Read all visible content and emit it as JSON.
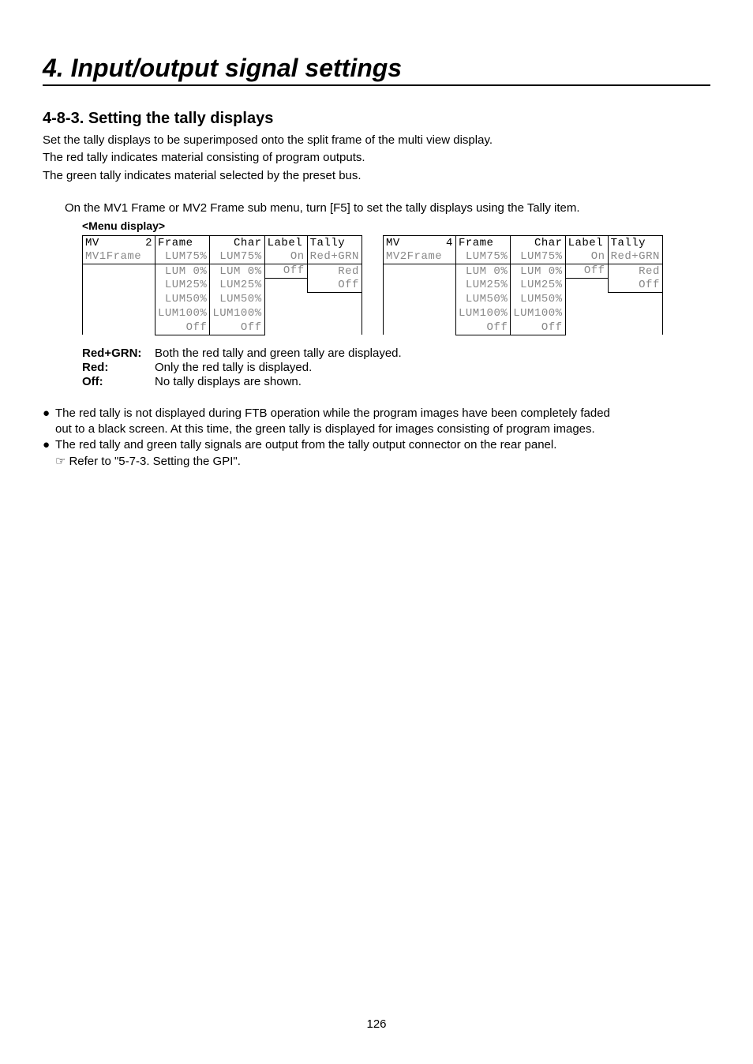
{
  "chapter_title": "4. Input/output signal settings",
  "section_number": "4-8-3.",
  "section_title": "Setting the tally displays",
  "intro_lines": [
    "Set the tally displays to be superimposed onto the split frame of the multi view display.",
    "The red tally indicates material consisting of program outputs.",
    "The green tally indicates material selected by the preset bus."
  ],
  "step_line": "On the MV1 Frame or MV2 Frame sub menu, turn [F5] to set the tally displays using the Tally item.",
  "menu_display_label": "<Menu display>",
  "table_left": {
    "hdr": {
      "menu": "MV",
      "page": "2",
      "frame": "Frame",
      "char": "Char",
      "label": "Label",
      "tally": "Tally"
    },
    "val": {
      "menu": "MV1Frame",
      "frame": "LUM75%",
      "char": "LUM75%",
      "label": "On",
      "tally": "Red+GRN"
    },
    "opts": [
      {
        "frame": "LUM 0%",
        "char": "LUM 0%",
        "label": "Off",
        "tally": "Red"
      },
      {
        "frame": "LUM25%",
        "char": "LUM25%",
        "label": "",
        "tally": "Off"
      },
      {
        "frame": "LUM50%",
        "char": "LUM50%",
        "label": "",
        "tally": ""
      },
      {
        "frame": "LUM100%",
        "char": "LUM100%",
        "label": "",
        "tally": ""
      },
      {
        "frame": "Off",
        "char": "Off",
        "label": "",
        "tally": ""
      }
    ]
  },
  "table_right": {
    "hdr": {
      "menu": "MV",
      "page": "4",
      "frame": "Frame",
      "char": "Char",
      "label": "Label",
      "tally": "Tally"
    },
    "val": {
      "menu": "MV2Frame",
      "frame": "LUM75%",
      "char": "LUM75%",
      "label": "On",
      "tally": "Red+GRN"
    },
    "opts": [
      {
        "frame": "LUM 0%",
        "char": "LUM 0%",
        "label": "Off",
        "tally": "Red"
      },
      {
        "frame": "LUM25%",
        "char": "LUM25%",
        "label": "",
        "tally": "Off"
      },
      {
        "frame": "LUM50%",
        "char": "LUM50%",
        "label": "",
        "tally": ""
      },
      {
        "frame": "LUM100%",
        "char": "LUM100%",
        "label": "",
        "tally": ""
      },
      {
        "frame": "Off",
        "char": "Off",
        "label": "",
        "tally": ""
      }
    ]
  },
  "legend": {
    "redgrn": {
      "key": "Red+GRN:",
      "desc": "Both the red tally and green tally are displayed."
    },
    "red": {
      "key": "Red:",
      "desc": "Only the red tally is displayed."
    },
    "off": {
      "key": "Off:",
      "desc": "No tally displays are shown."
    }
  },
  "bullets": {
    "b1_line1": "The red tally is not displayed during FTB operation while the program images have been completely faded",
    "b1_line2": "out to a black screen. At this time, the green tally is displayed for images consisting of program images.",
    "b2_line1": "The red tally and green tally signals are output from the tally output connector on the rear panel.",
    "ref": "Refer to \"5-7-3. Setting the GPI\"."
  },
  "hand_glyph": "☞",
  "dot_glyph": "●",
  "page_number": "126"
}
